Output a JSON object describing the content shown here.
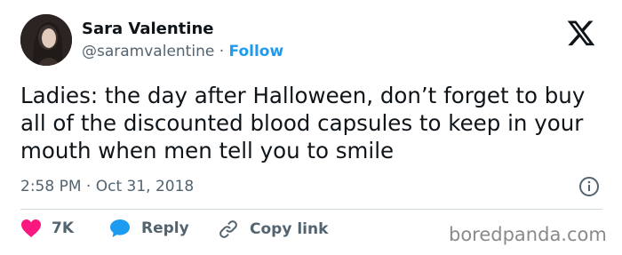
{
  "author": {
    "name": "Sara Valentine",
    "handle": "@saramvalentine",
    "separator": "·",
    "follow_label": "Follow"
  },
  "tweet": {
    "text": "Ladies: the day after Halloween, don’t forget to buy all of the discounted blood capsules to keep in your mouth when men tell you to smile",
    "time": "2:58 PM",
    "date": "Oct 31, 2018"
  },
  "actions": {
    "like_count": "7K",
    "reply_label": "Reply",
    "copy_label": "Copy link"
  },
  "watermark": "boredpanda.com",
  "colors": {
    "accent": "#1d9bf0",
    "heart": "#f91880",
    "text": "#0f1419",
    "muted": "#536471"
  },
  "icons": [
    "x-logo-icon",
    "info-icon",
    "heart-icon",
    "reply-bubble-icon",
    "link-icon"
  ]
}
